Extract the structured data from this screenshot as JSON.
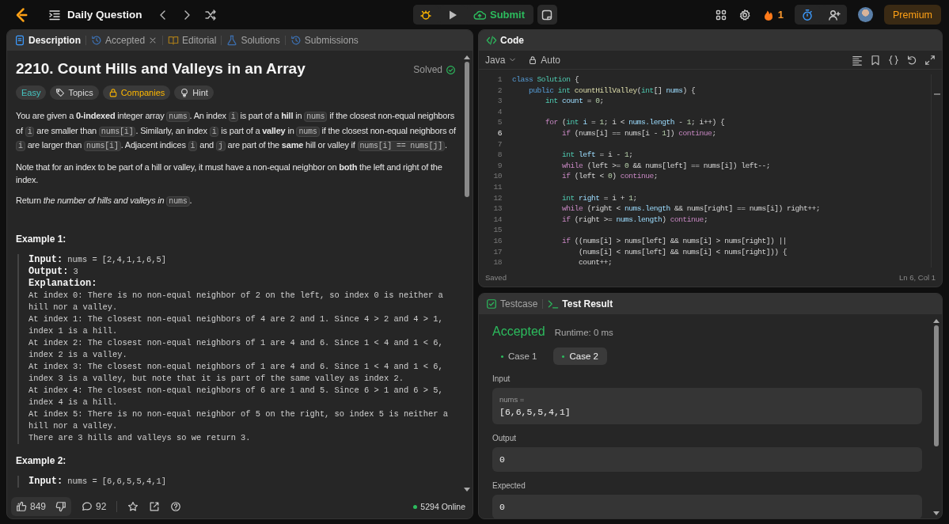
{
  "topbar": {
    "title": "Daily Question",
    "submit": "Submit",
    "streak": "1",
    "premium": "Premium"
  },
  "description_panel": {
    "tabs": [
      {
        "label": "Description",
        "selected": true,
        "closable": false
      },
      {
        "label": "Accepted",
        "selected": false,
        "closable": true
      },
      {
        "label": "Editorial",
        "selected": false,
        "closable": false
      },
      {
        "label": "Solutions",
        "selected": false,
        "closable": false
      },
      {
        "label": "Submissions",
        "selected": false,
        "closable": false
      }
    ],
    "title": "2210. Count Hills and Valleys in an Array",
    "status": "Solved",
    "tags": [
      {
        "label": "Easy",
        "kind": "difficulty"
      },
      {
        "label": "Topics",
        "kind": "topics"
      },
      {
        "label": "Companies",
        "kind": "companies"
      },
      {
        "label": "Hint",
        "kind": "hint"
      }
    ],
    "paragraphs": [
      [
        {
          "kind": "text",
          "text": "You are given a **0-indexed** integer array "
        },
        {
          "kind": "code",
          "text": "nums"
        },
        {
          "kind": "text",
          "text": ". An index "
        },
        {
          "kind": "code",
          "text": "i"
        },
        {
          "kind": "text",
          "text": " is part of a **hill** in "
        },
        {
          "kind": "code",
          "text": "nums"
        },
        {
          "kind": "text",
          "text": " if the closest non-equal neighbors of "
        },
        {
          "kind": "code",
          "text": "i"
        },
        {
          "kind": "text",
          "text": " are smaller than "
        },
        {
          "kind": "code",
          "text": "nums[i]"
        },
        {
          "kind": "text",
          "text": ". Similarly, an index "
        },
        {
          "kind": "code",
          "text": "i"
        },
        {
          "kind": "text",
          "text": " is part of a **valley** in "
        },
        {
          "kind": "code",
          "text": "nums"
        },
        {
          "kind": "text",
          "text": " if the closest non-equal neighbors of "
        },
        {
          "kind": "code",
          "text": "i"
        },
        {
          "kind": "text",
          "text": " are larger than "
        },
        {
          "kind": "code",
          "text": "nums[i]"
        },
        {
          "kind": "text",
          "text": ". Adjacent indices "
        },
        {
          "kind": "code",
          "text": "i"
        },
        {
          "kind": "text",
          "text": " and "
        },
        {
          "kind": "code",
          "text": "j"
        },
        {
          "kind": "text",
          "text": " are part of the **same** hill or valley if "
        },
        {
          "kind": "code",
          "text": "nums[i] == nums[j]"
        },
        {
          "kind": "text",
          "text": "."
        }
      ],
      [
        {
          "kind": "text",
          "text": "Note that for an index to be part of a hill or valley, it must have a non-equal neighbor on **both** the left and right of the index."
        }
      ],
      [
        {
          "kind": "text",
          "text": "Return *the number of hills and valleys in* "
        },
        {
          "kind": "code",
          "text": "nums"
        },
        {
          "kind": "text",
          "text": "."
        }
      ]
    ],
    "examples": [
      {
        "heading": "Example 1:",
        "rows": [
          {
            "label": "Input:",
            "value": "nums = [2,4,1,1,6,5]"
          },
          {
            "label": "Output:",
            "value": "3"
          },
          {
            "label": "Explanation:"
          }
        ],
        "lines": [
          "At index 0: There is no non-equal neighbor of 2 on the left, so index 0 is neither a hill nor a valley.",
          "At index 1: The closest non-equal neighbors of 4 are 2 and 1. Since 4 > 2 and 4 > 1, index 1 is a hill.",
          "At index 2: The closest non-equal neighbors of 1 are 4 and 6. Since 1 < 4 and 1 < 6, index 2 is a valley.",
          "At index 3: The closest non-equal neighbors of 1 are 4 and 6. Since 1 < 4 and 1 < 6, index 3 is a valley, but note that it is part of the same valley as index 2.",
          "At index 4: The closest non-equal neighbors of 6 are 1 and 5. Since 6 > 1 and 6 > 5, index 4 is a hill.",
          "At index 5: There is no non-equal neighbor of 5 on the right, so index 5 is neither a hill nor a valley.",
          "There are 3 hills and valleys so we return 3."
        ]
      },
      {
        "heading": "Example 2:",
        "rows": [
          {
            "label": "Input:",
            "value": "nums = [6,6,5,5,4,1]"
          }
        ]
      }
    ],
    "footer": {
      "likes": "849",
      "comments": "92",
      "online": "5294 Online"
    }
  },
  "code_panel": {
    "title": "Code",
    "language": "Java",
    "mode": "Auto",
    "lines": [
      {
        "number": "1",
        "current": false,
        "tokens": [
          {
            "kind": "keyword",
            "text": "class"
          },
          {
            "kind": "type",
            "text": " Solution"
          },
          {
            "kind": "plain",
            "text": " {"
          }
        ]
      },
      {
        "number": "2",
        "current": false,
        "tokens": [
          {
            "kind": "keyword",
            "text": "    public"
          },
          {
            "kind": "type",
            "text": " int"
          },
          {
            "kind": "function",
            "text": " countHillValley"
          },
          {
            "kind": "plain",
            "text": "("
          },
          {
            "kind": "type",
            "text": "int"
          },
          {
            "kind": "plain",
            "text": "[]"
          },
          {
            "kind": "variable",
            "text": " nums"
          },
          {
            "kind": "plain",
            "text": ") {"
          }
        ]
      },
      {
        "number": "3",
        "current": false,
        "tokens": [
          {
            "kind": "type",
            "text": "        int"
          },
          {
            "kind": "variable",
            "text": " count"
          },
          {
            "kind": "plain",
            "text": " ="
          },
          {
            "kind": "number",
            "text": " 0"
          },
          {
            "kind": "plain",
            "text": ";"
          }
        ]
      },
      {
        "number": "4",
        "current": false
      },
      {
        "number": "5",
        "current": false,
        "tokens": [
          {
            "kind": "control",
            "text": "        for"
          },
          {
            "kind": "plain",
            "text": " ("
          },
          {
            "kind": "type",
            "text": "int"
          },
          {
            "kind": "variable",
            "text": " i"
          },
          {
            "kind": "plain",
            "text": " ="
          },
          {
            "kind": "number",
            "text": " 1"
          },
          {
            "kind": "plain",
            "text": "; i <"
          },
          {
            "kind": "variable",
            "text": " nums.length"
          },
          {
            "kind": "plain",
            "text": " -"
          },
          {
            "kind": "number",
            "text": " 1"
          },
          {
            "kind": "plain",
            "text": "; i++) {"
          }
        ]
      },
      {
        "number": "6",
        "current": true,
        "tokens": [
          {
            "kind": "control",
            "text": "            if"
          },
          {
            "kind": "plain",
            "text": " (nums[i] == nums[i -"
          },
          {
            "kind": "number",
            "text": " 1"
          },
          {
            "kind": "plain",
            "text": "])"
          },
          {
            "kind": "control",
            "text": " continue"
          },
          {
            "kind": "plain",
            "text": ";"
          }
        ]
      },
      {
        "number": "7",
        "current": false
      },
      {
        "number": "8",
        "current": false,
        "tokens": [
          {
            "kind": "type",
            "text": "            int"
          },
          {
            "kind": "variable",
            "text": " left"
          },
          {
            "kind": "plain",
            "text": " = i -"
          },
          {
            "kind": "number",
            "text": " 1"
          },
          {
            "kind": "plain",
            "text": ";"
          }
        ]
      },
      {
        "number": "9",
        "current": false,
        "tokens": [
          {
            "kind": "control",
            "text": "            while"
          },
          {
            "kind": "plain",
            "text": " (left >="
          },
          {
            "kind": "number",
            "text": " 0"
          },
          {
            "kind": "plain",
            "text": " && nums[left] == nums[i]) left--;"
          }
        ]
      },
      {
        "number": "10",
        "current": false,
        "tokens": [
          {
            "kind": "control",
            "text": "            if"
          },
          {
            "kind": "plain",
            "text": " (left <"
          },
          {
            "kind": "number",
            "text": " 0"
          },
          {
            "kind": "plain",
            "text": ")"
          },
          {
            "kind": "control",
            "text": " continue"
          },
          {
            "kind": "plain",
            "text": ";"
          }
        ]
      },
      {
        "number": "11",
        "current": false
      },
      {
        "number": "12",
        "current": false,
        "tokens": [
          {
            "kind": "type",
            "text": "            int"
          },
          {
            "kind": "variable",
            "text": " right"
          },
          {
            "kind": "plain",
            "text": " = i +"
          },
          {
            "kind": "number",
            "text": " 1"
          },
          {
            "kind": "plain",
            "text": ";"
          }
        ]
      },
      {
        "number": "13",
        "current": false,
        "tokens": [
          {
            "kind": "control",
            "text": "            while"
          },
          {
            "kind": "plain",
            "text": " (right <"
          },
          {
            "kind": "variable",
            "text": " nums.length"
          },
          {
            "kind": "plain",
            "text": " && nums[right] == nums[i]) right++;"
          }
        ]
      },
      {
        "number": "14",
        "current": false,
        "tokens": [
          {
            "kind": "control",
            "text": "            if"
          },
          {
            "kind": "plain",
            "text": " (right >="
          },
          {
            "kind": "variable",
            "text": " nums.length"
          },
          {
            "kind": "plain",
            "text": ")"
          },
          {
            "kind": "control",
            "text": " continue"
          },
          {
            "kind": "plain",
            "text": ";"
          }
        ]
      },
      {
        "number": "15",
        "current": false
      },
      {
        "number": "16",
        "current": false,
        "tokens": [
          {
            "kind": "control",
            "text": "            if"
          },
          {
            "kind": "plain",
            "text": " ((nums[i] > nums[left] && nums[i] > nums[right]) ||"
          }
        ]
      },
      {
        "number": "17",
        "current": false,
        "tokens": [
          {
            "kind": "plain",
            "text": "                (nums[i] < nums[left] && nums[i] < nums[right])) {"
          }
        ]
      },
      {
        "number": "18",
        "current": false,
        "tokens": [
          {
            "kind": "plain",
            "text": "                count++;"
          }
        ]
      }
    ],
    "status": "Saved",
    "cursor": "Ln 6, Col 1"
  },
  "result_panel": {
    "tabs": [
      {
        "label": "Testcase",
        "selected": false
      },
      {
        "label": "Test Result",
        "selected": true
      }
    ],
    "verdict": "Accepted",
    "runtime": "Runtime: 0 ms",
    "cases": [
      {
        "label": "Case 1",
        "selected": false
      },
      {
        "label": "Case 2",
        "selected": true
      }
    ],
    "sections": [
      {
        "label": "Input",
        "name": "nums =",
        "value": "[6,6,5,5,4,1]"
      },
      {
        "label": "Output",
        "value": "0"
      },
      {
        "label": "Expected",
        "value": "0"
      }
    ]
  }
}
